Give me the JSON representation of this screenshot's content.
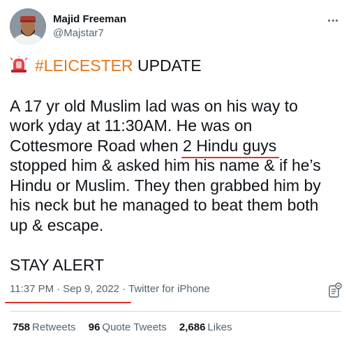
{
  "author": {
    "display_name": "Majid Freeman",
    "handle": "@Majstar7"
  },
  "tweet": {
    "emoji_icon": "police-car-light-icon",
    "hashtag": "#LEICESTER",
    "headline_rest": " UPDATE",
    "body_lines": [
      "A 17 yr old Muslim lad was on his way to",
      "work yday at 11:30AM. He was on",
      "Cottesmore Road when ",
      "2 Hindu guys",
      "stopped him & asked him his name & if he’s",
      "Hindu or Muslim. They then grabbed him by",
      "his neck but he managed to beat them both",
      "up & escape."
    ],
    "closing": "STAY ALERT"
  },
  "meta": {
    "time": "11:37 PM",
    "date": "Sep 9, 2022",
    "source": "Twitter for iPhone",
    "separator": "·"
  },
  "stats": {
    "retweets_count": "758",
    "retweets_label": "Retweets",
    "quotes_count": "96",
    "quotes_label": "Quote Tweets",
    "likes_count": "2,686",
    "likes_label": "Likes"
  },
  "colors": {
    "hashtag": "#e8761a",
    "annotation_underline": "#e0322b",
    "secondary_text": "#536471"
  }
}
